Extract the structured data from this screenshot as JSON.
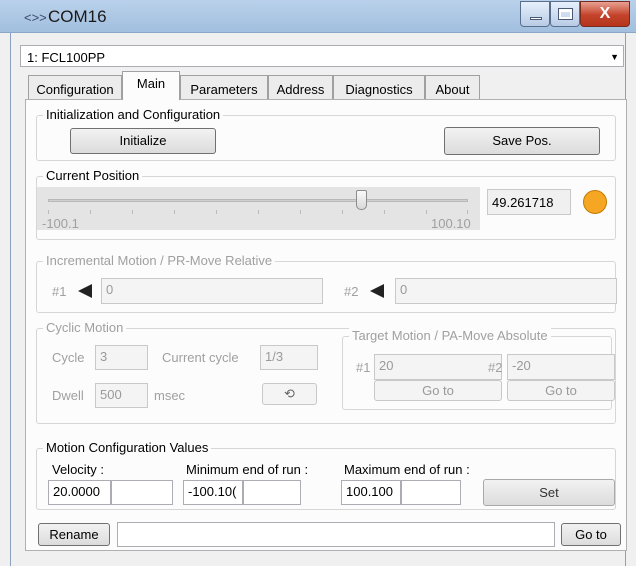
{
  "window": {
    "title": "COM16",
    "min_label": "",
    "max_label": "",
    "close_label": "X"
  },
  "device_select": {
    "value": "1: FCL100PP"
  },
  "tabs": [
    "Configuration",
    "Main",
    "Parameters",
    "Address",
    "Diagnostics",
    "About"
  ],
  "init": {
    "group_label": "Initialization and Configuration",
    "initialize_label": "Initialize",
    "save_label": "Save Pos."
  },
  "position": {
    "group_label": "Current Position",
    "min_label": "-100.1",
    "max_label": "100.10",
    "value": "49.261718",
    "slider_fraction": 0.745,
    "indicator_color": "#f5a623"
  },
  "incremental": {
    "group_label": "Incremental Motion / PR-Move Relative",
    "label1": "#1",
    "value1": "0",
    "label2": "#2",
    "value2": "0"
  },
  "cyclic": {
    "group_label": "Cyclic Motion",
    "cycle_label": "Cycle",
    "cycle_value": "3",
    "current_cycle_label": "Current cycle",
    "current_cycle_value": "1/3",
    "dwell_label": "Dwell",
    "dwell_value": "500",
    "dwell_unit": "msec"
  },
  "target": {
    "group_label": "Target Motion / PA-Move Absolute",
    "label1": "#1",
    "value1": "20",
    "goto1": "Go to",
    "label2": "#2",
    "value2": "-20",
    "goto2": "Go to"
  },
  "config": {
    "group_label": "Motion Configuration Values",
    "velocity_label": "Velocity :",
    "velocity_value": "20.0000",
    "min_label": "Minimum end of run :",
    "min_value": "-100.10(",
    "max_label": "Maximum end of run :",
    "max_value": "100.100",
    "set_label": "Set"
  },
  "bottom": {
    "rename_label": "Rename",
    "combo_value": "",
    "goto_label": "Go to"
  }
}
